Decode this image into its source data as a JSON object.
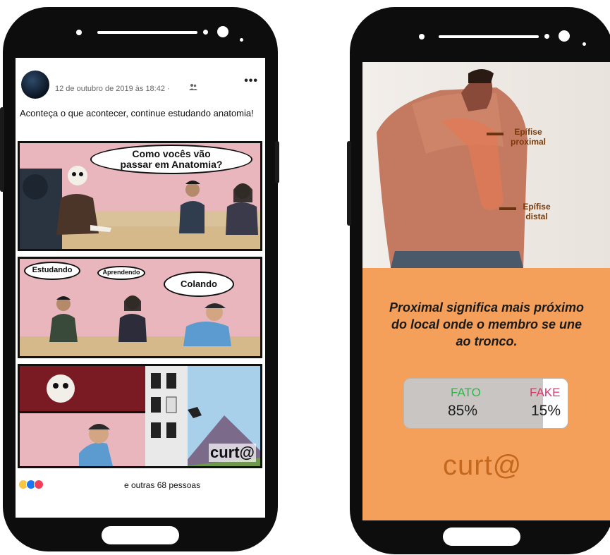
{
  "left_phone": {
    "post": {
      "date": "12 de outubro de 2019 às 18:42 ·",
      "audience_icon": "friends-icon",
      "more_icon": "more-dots-icon",
      "caption": "Aconteça o que acontecer, continue estudando anatomia!"
    },
    "comic": {
      "question_bubble": "Como vocês vão passar em Anatomia?",
      "answer_1": "Estudando",
      "answer_2": "Aprendendo",
      "answer_3": "Colando",
      "watermark": "curt@"
    },
    "reactions": {
      "icons": [
        "haha-reaction-icon",
        "like-reaction-icon",
        "love-reaction-icon"
      ],
      "others_text": "e outras 68 pessoas"
    }
  },
  "right_phone": {
    "image_labels": {
      "proximal": "Epífise proximal",
      "distal": "Epífise distal"
    },
    "question": "Proximal significa mais próximo do local onde o membro se une ao tronco.",
    "poll": {
      "option_fato": "FATO",
      "option_fake": "FAKE",
      "fato_percent": "85%",
      "fake_percent": "15%",
      "fato_value": 0.85,
      "fake_value": 0.15,
      "fato_color": "#2db84a",
      "fake_color": "#e0346e"
    },
    "brand": "curt@"
  },
  "colors": {
    "story_background": "#f5a05a",
    "phone_frame": "#0d0d0d",
    "comic_wall": "#e8b6bc"
  }
}
